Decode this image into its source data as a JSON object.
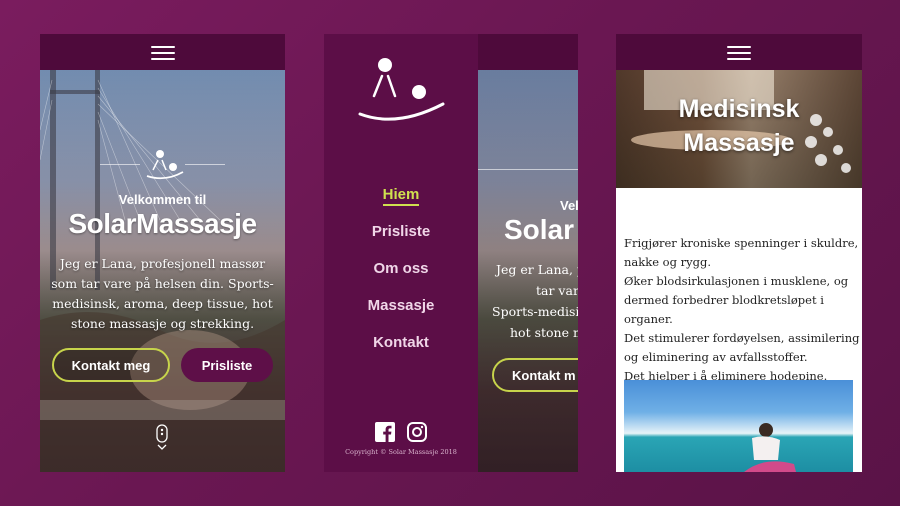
{
  "screen1": {
    "welcome": "Velkommen til",
    "brand": "SolarMassasje",
    "intro": "Jeg er Lana, profesjonell massør som tar vare på helsen din. Sports-medisinsk, aroma, deep tissue, hot stone massasje og strekking.",
    "btn_contact": "Kontakt meg",
    "btn_prices": "Prisliste"
  },
  "menu": {
    "items": [
      {
        "label": "Hiem",
        "active": true
      },
      {
        "label": "Prisliste",
        "active": false
      },
      {
        "label": "Om oss",
        "active": false
      },
      {
        "label": "Massasje",
        "active": false
      },
      {
        "label": "Kontakt",
        "active": false
      }
    ],
    "copyright": "Copyright © Solar Massasje 2018",
    "social": [
      "facebook-icon",
      "instagram-icon"
    ]
  },
  "peek": {
    "welcome": "Velk",
    "brand": "Solar",
    "lines": [
      "Jeg er Lana, p",
      "tar vare",
      "Sports-medisin",
      "hot stone m"
    ],
    "btn": "Kontakt m"
  },
  "screen3": {
    "title_line1": "Medisinsk",
    "title_line2": "Massasje",
    "paragraphs": [
      "Frigjører kroniske spenninger i skuldre, nakke og rygg.",
      "Øker blodsirkulasjonen i musklene, og dermed forbedrer blodkretsløpet i organer.",
      "Det stimulerer fordøyelsen, assimilering og eliminering av avfallsstoffer.",
      "Det hjelper i å eliminere hodepine."
    ]
  },
  "colors": {
    "background": "#6a1752",
    "header": "#4e0a3b",
    "menu_panel": "#5c0e47",
    "accent": "#cfe04f"
  }
}
